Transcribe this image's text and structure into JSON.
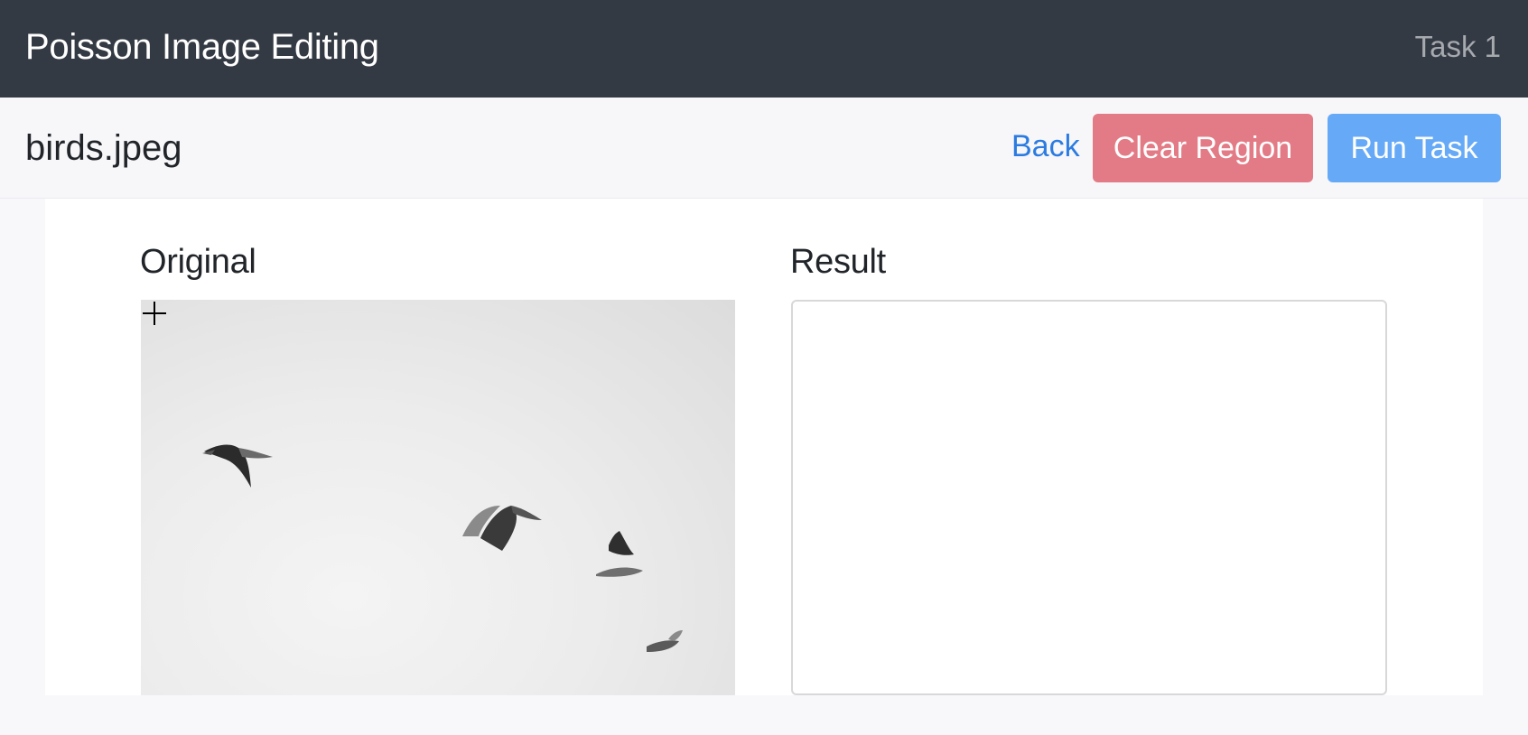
{
  "header": {
    "app_title": "Poisson Image Editing",
    "task_label": "Task 1"
  },
  "toolbar": {
    "file_name": "birds.jpeg",
    "back_label": "Back",
    "clear_label": "Clear Region",
    "run_label": "Run Task"
  },
  "panels": {
    "original_title": "Original",
    "result_title": "Result"
  },
  "icons": {
    "cursor": "crosshair-icon"
  },
  "colors": {
    "header_bg": "#343a44",
    "clear_button": "#e37b86",
    "run_button": "#66aaf7",
    "link": "#2b7be0"
  }
}
